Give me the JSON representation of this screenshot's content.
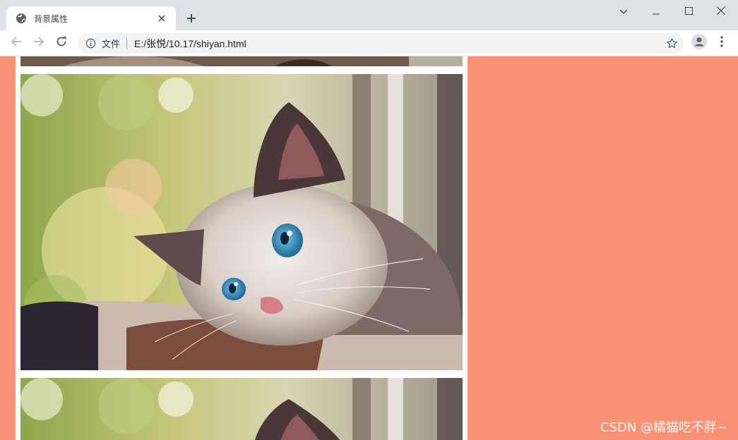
{
  "browser": {
    "tab_title": "背景属性",
    "omnibox_security_label": "文件",
    "url": "E:/张悦/10.17/shiyan.html"
  },
  "icons": {
    "favicon": "globe-icon",
    "tab_close": "close-icon",
    "new_tab": "plus-icon",
    "minimize": "minimize-icon",
    "maximize": "maximize-icon",
    "close_window": "close-window-icon",
    "tab_search": "chevron-down-icon",
    "back": "back-arrow-icon",
    "forward": "forward-arrow-icon",
    "reload": "reload-icon",
    "info": "info-icon",
    "bookmark": "star-icon",
    "profile": "profile-icon",
    "menu": "kebab-menu-icon"
  },
  "page": {
    "background_color": "#fa9175",
    "column_color": "#ffffff",
    "images_alt": [
      "kitten photo (partially visible)",
      "kitten photo",
      "kitten photo (partially visible)"
    ]
  },
  "watermark": "CSDN @橘猫吃不胖~"
}
